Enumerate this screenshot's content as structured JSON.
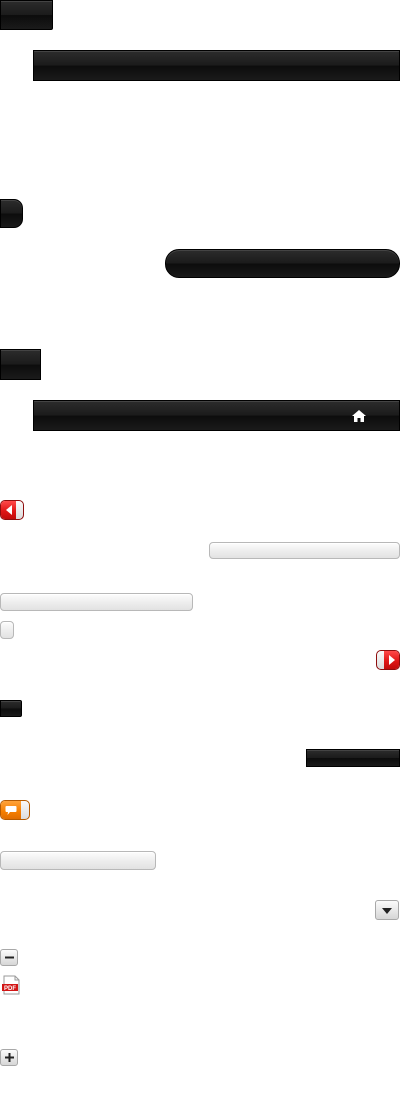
{
  "icons": {
    "home": "home-icon",
    "back": "arrow-left-icon",
    "forward": "arrow-right-icon",
    "comment": "speech-bubble-icon",
    "dropdown": "triangle-down-icon",
    "remove": "minus-icon",
    "pdf": "pdf-icon",
    "add": "plus-icon"
  },
  "pdf_badge_text": "PDF",
  "colors": {
    "dark": "#1b1b1b",
    "red_accent": "#e01717",
    "orange_accent": "#f57e00",
    "light_grey": "#e8e8e8"
  }
}
